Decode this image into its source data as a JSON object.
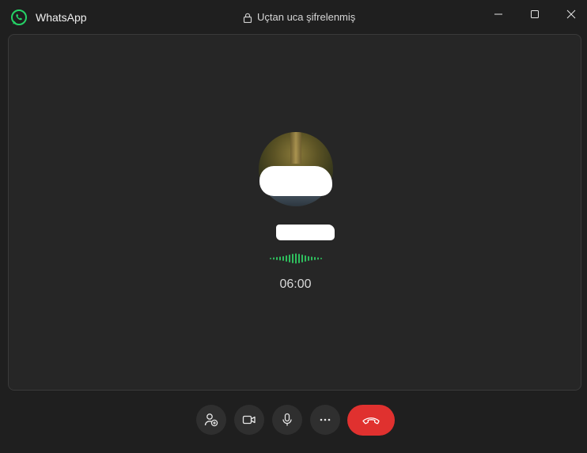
{
  "titlebar": {
    "app_name": "WhatsApp",
    "encryption_label": "Uçtan uca şifrelenmiş"
  },
  "call": {
    "timer": "06:00",
    "contact_name": "",
    "status": "voice-activity-indicator"
  },
  "controls": {
    "add_participant": "person-add-icon",
    "video": "video-icon",
    "mute": "microphone-icon",
    "more": "ellipsis-icon",
    "end_call": "phone-hangup-icon"
  },
  "colors": {
    "brand_green": "#25D366",
    "end_call_red": "#E0312F",
    "wave_green": "#2FBF5E"
  }
}
